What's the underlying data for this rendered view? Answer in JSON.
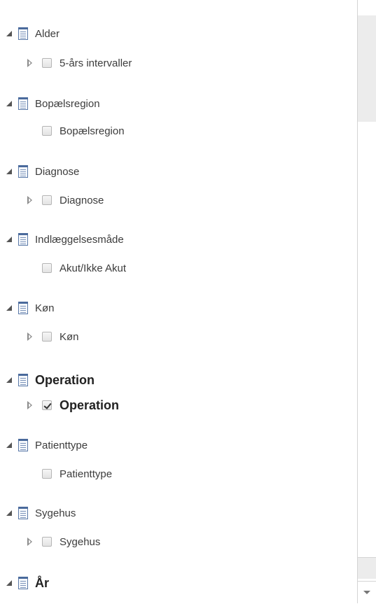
{
  "groups": [
    {
      "label": "Alder",
      "child_label": "5-års intervaller",
      "has_expander": true,
      "checked": false,
      "bold": false
    },
    {
      "label": "Bopælsregion",
      "child_label": "Bopælsregion",
      "has_expander": false,
      "checked": false,
      "bold": false
    },
    {
      "label": "Diagnose",
      "child_label": "Diagnose",
      "has_expander": true,
      "checked": false,
      "bold": false
    },
    {
      "label": "Indlæggelsesmåde",
      "child_label": "Akut/Ikke Akut",
      "has_expander": false,
      "checked": false,
      "bold": false
    },
    {
      "label": "Køn",
      "child_label": "Køn",
      "has_expander": true,
      "checked": false,
      "bold": false
    },
    {
      "label": "Operation",
      "child_label": "Operation",
      "has_expander": true,
      "checked": true,
      "bold": true
    },
    {
      "label": "Patienttype",
      "child_label": "Patienttype",
      "has_expander": false,
      "checked": false,
      "bold": false
    },
    {
      "label": "Sygehus",
      "child_label": "Sygehus",
      "has_expander": true,
      "checked": false,
      "bold": false
    },
    {
      "label": "År",
      "bold": true
    }
  ],
  "scrollbar": {
    "down_arrow_icon": "chevron-down-icon"
  }
}
